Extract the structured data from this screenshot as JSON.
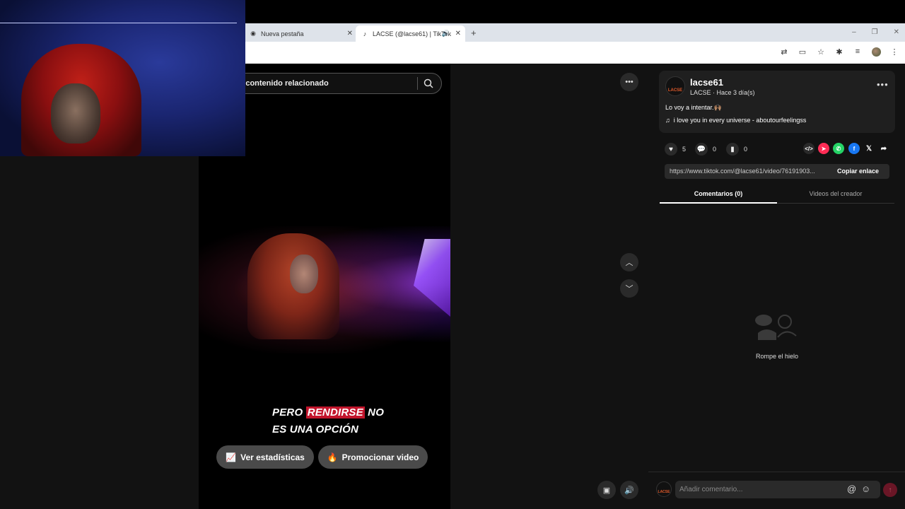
{
  "browser": {
    "tabs": [
      {
        "title": "Nueva pestaña",
        "icon": "chrome-icon"
      },
      {
        "title": "LACSE (@lacse61) | TikTok",
        "icon": "tiktok-icon",
        "active": true
      }
    ],
    "new_tab": "+",
    "window_controls": [
      "–",
      "❐",
      "✕"
    ]
  },
  "search": {
    "placeholder": "r contenido relacionado"
  },
  "video": {
    "caption_line1_pre": "PERO ",
    "caption_line1_highlight": "RENDIRSE",
    "caption_line1_post": " NO",
    "caption_line2": "ES UNA OPCIÓN",
    "stats_button": "Ver estadísticas",
    "promote_button": "Promocionar video"
  },
  "post": {
    "author": "lacse61",
    "avatar_text": "LACSE",
    "meta": "LACSE · Hace 3 día(s)",
    "description": "Lo voy a intentar.🙌🏽",
    "music": "i love you in every universe - aboutourfeelingss",
    "likes": "5",
    "comments": "0",
    "saves": "0",
    "link": "https://www.tiktok.com/@lacse61/video/76191903...",
    "copy_link": "Copiar enlace"
  },
  "tabs": {
    "comments": "Comentarios (0)",
    "creator_videos": "Videos del creador"
  },
  "empty": {
    "text": "Rompe el hielo"
  },
  "comment_bar": {
    "placeholder": "Añadir comentario...",
    "avatar_text": "LACSE"
  },
  "colors": {
    "accent": "#fe2c55",
    "caption_highlight": "#c2152c",
    "panel_bg": "#121212"
  }
}
